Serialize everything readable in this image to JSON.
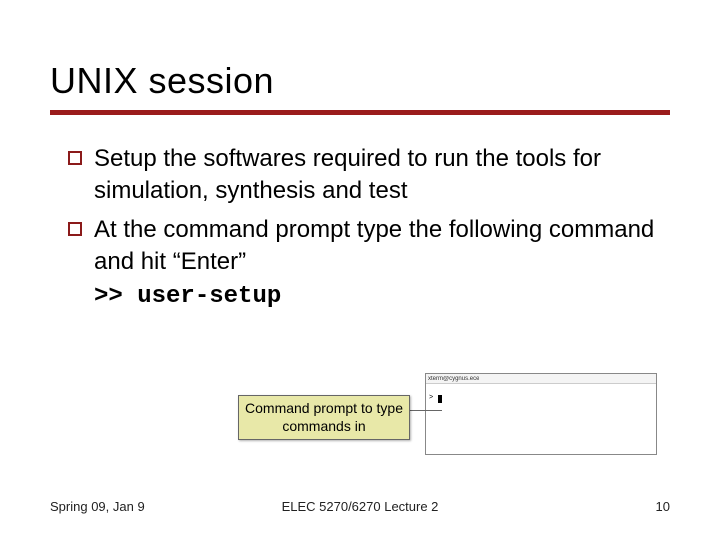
{
  "title": "UNIX session",
  "bullets": {
    "b1": "Setup the softwares required to run the tools for simulation, synthesis and test",
    "b2": "At the command prompt type the following command and hit “Enter”",
    "cmd_prefix": ">> ",
    "cmd": "user-setup"
  },
  "callout": "Command prompt to type commands in",
  "terminal": {
    "titlebar": "xterm@cygnus.ece",
    "prompt": ">"
  },
  "footer": {
    "left": "Spring 09, Jan 9",
    "center": "ELEC 5270/6270 Lecture 2",
    "right": "10"
  }
}
